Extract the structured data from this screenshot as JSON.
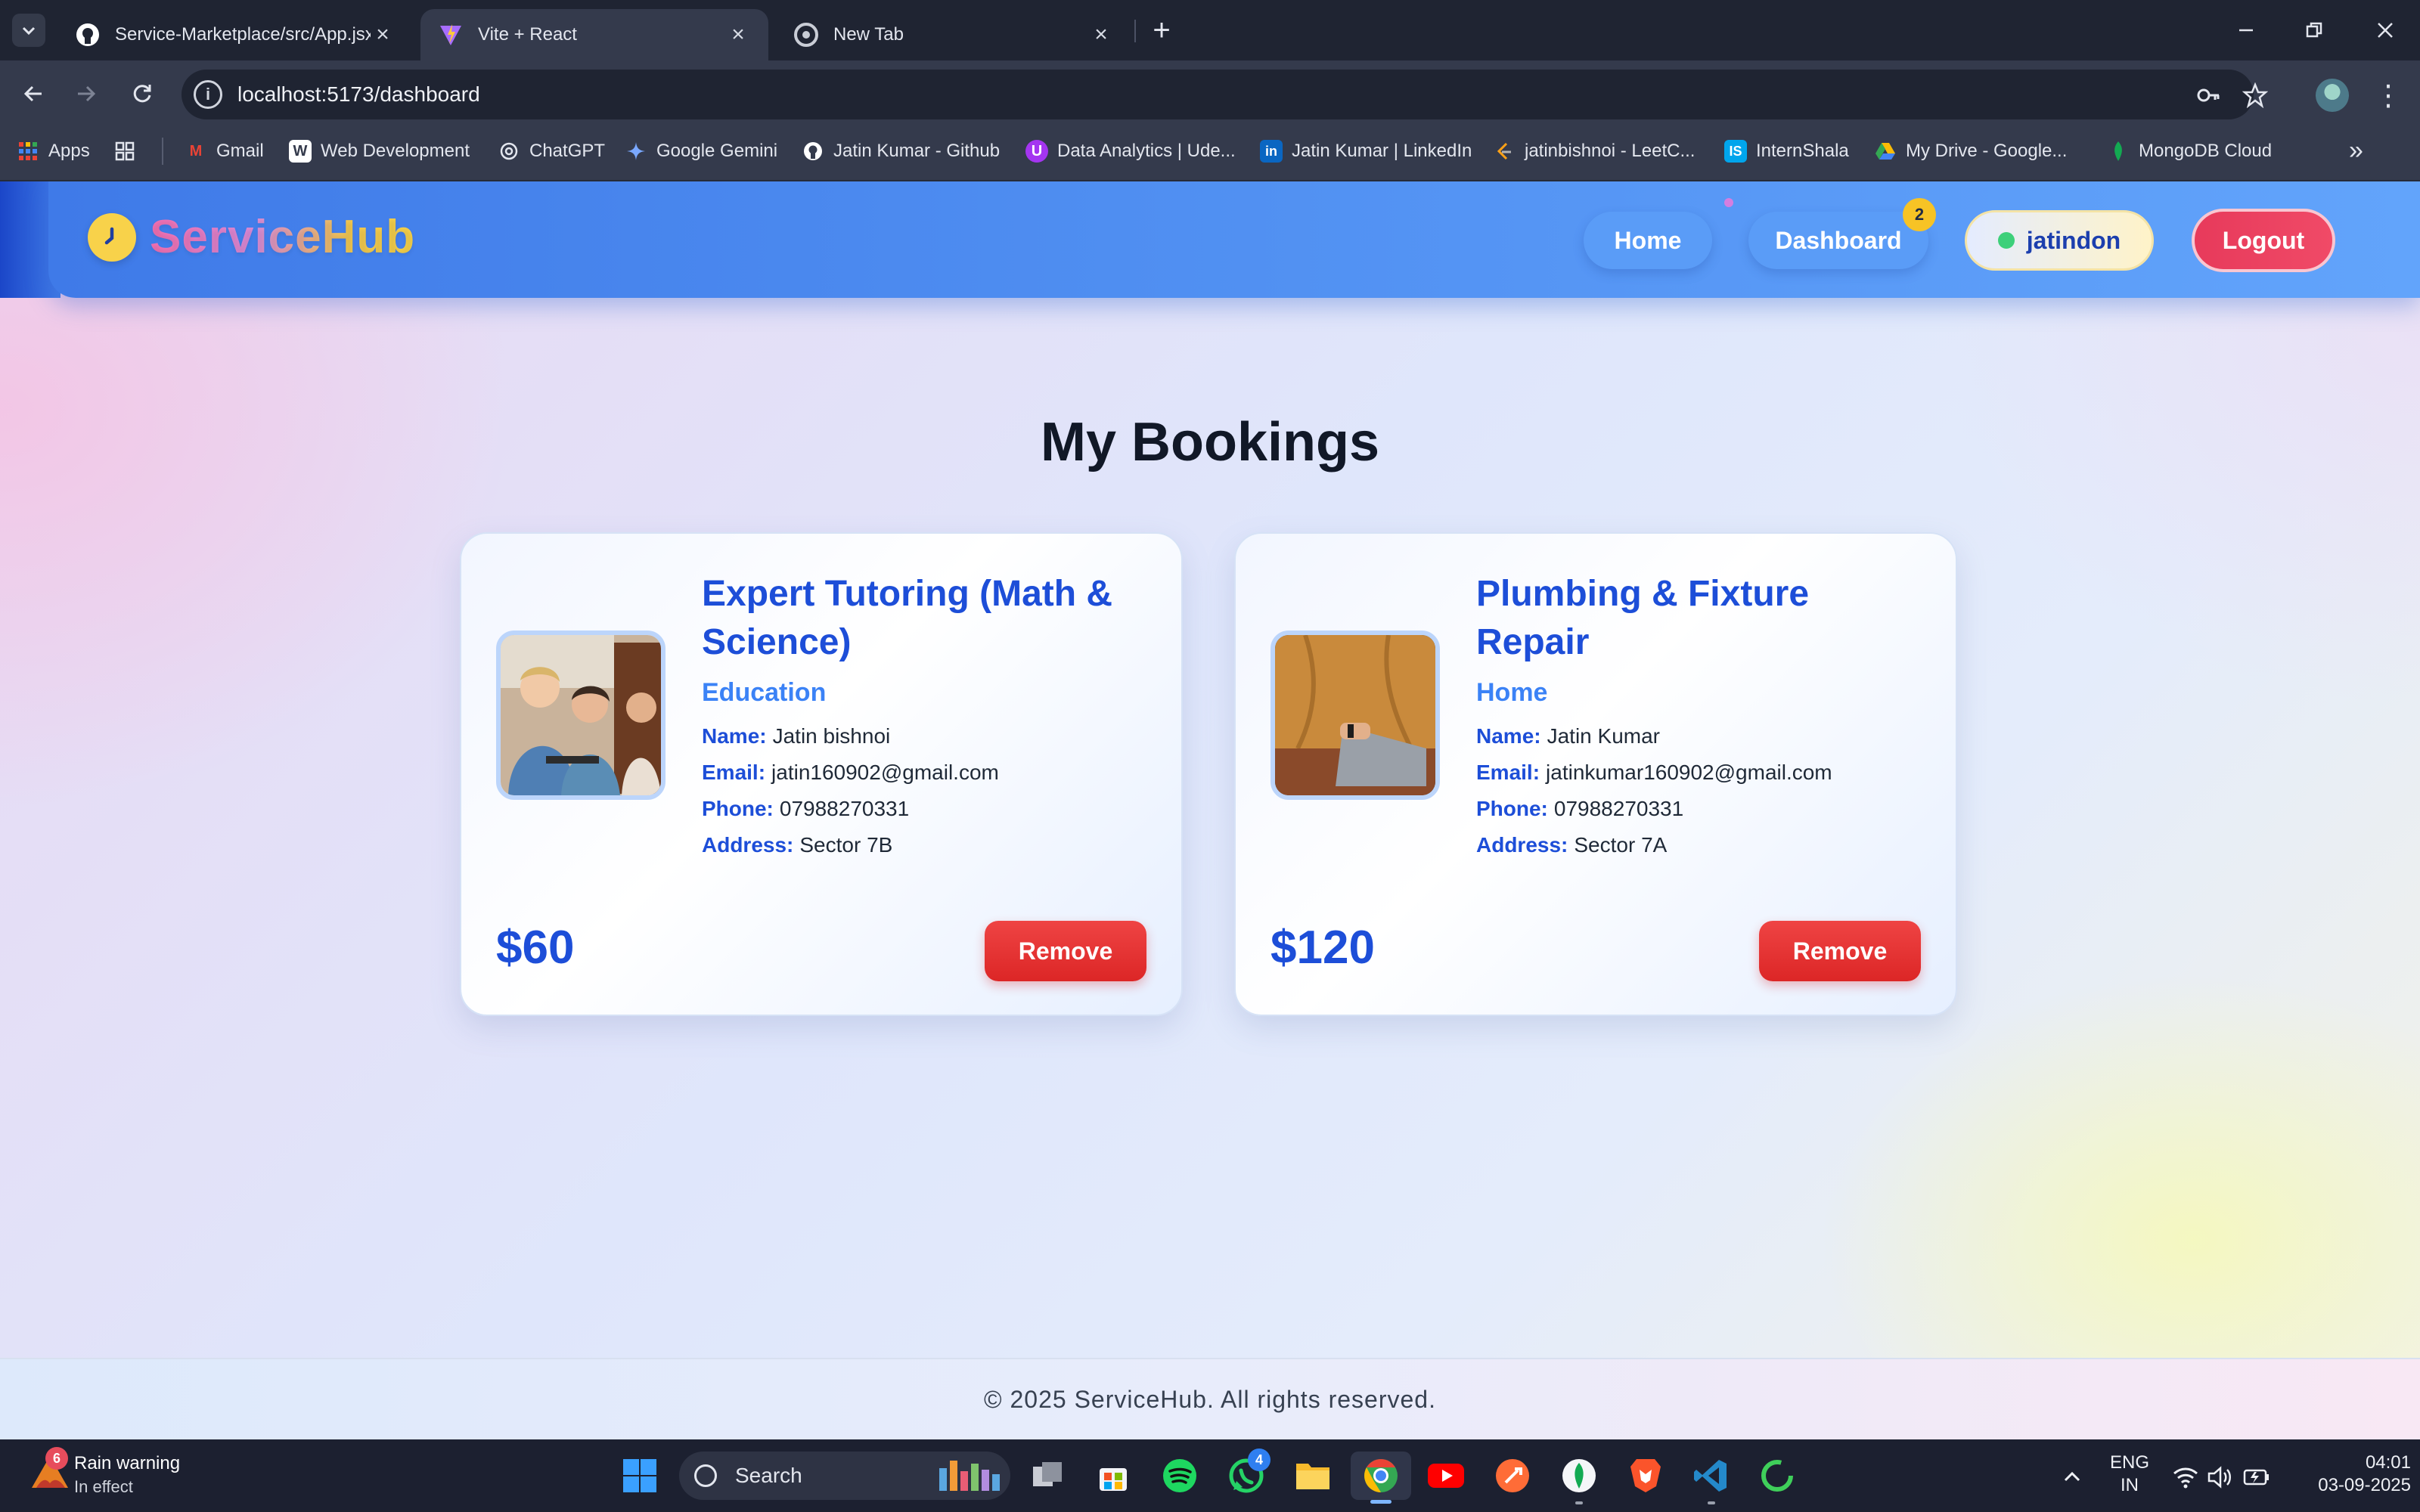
{
  "browser": {
    "tabs": [
      {
        "title": "Service-Marketplace/src/App.jsx",
        "favicon": "github-icon"
      },
      {
        "title": "Vite + React",
        "favicon": "vite-icon",
        "active": true
      },
      {
        "title": "New Tab",
        "favicon": "chrome-icon"
      }
    ],
    "url": "localhost:5173/dashboard",
    "bookmarks": [
      {
        "label": "Apps"
      },
      {
        "label": "Gmail"
      },
      {
        "label": "Web Development"
      },
      {
        "label": "ChatGPT"
      },
      {
        "label": "Google Gemini"
      },
      {
        "label": "Jatin Kumar - Github"
      },
      {
        "label": "Data Analytics | Ude..."
      },
      {
        "label": "Jatin Kumar | LinkedIn"
      },
      {
        "label": "jatinbishnoi - LeetC..."
      },
      {
        "label": "InternShala"
      },
      {
        "label": "My Drive - Google..."
      },
      {
        "label": "MongoDB Cloud"
      }
    ]
  },
  "app": {
    "brand": "ServiceHub",
    "nav": {
      "home": "Home",
      "dashboard": "Dashboard",
      "dashboard_badge": "2",
      "username": "jatindon",
      "logout": "Logout"
    },
    "heading": "My Bookings",
    "bookings": [
      {
        "title": "Expert Tutoring (Math & Science)",
        "category": "Education",
        "name_label": "Name:",
        "name": "Jatin bishnoi",
        "email_label": "Email:",
        "email": "jatin160902@gmail.com",
        "phone_label": "Phone:",
        "phone": "07988270331",
        "address_label": "Address:",
        "address": "Sector 7B",
        "price": "$60",
        "remove": "Remove"
      },
      {
        "title": "Plumbing & Fixture Repair",
        "category": "Home",
        "name_label": "Name:",
        "name": "Jatin Kumar",
        "email_label": "Email:",
        "email": "jatinkumar160902@gmail.com",
        "phone_label": "Phone:",
        "phone": "07988270331",
        "address_label": "Address:",
        "address": "Sector 7A",
        "price": "$120",
        "remove": "Remove"
      }
    ],
    "footer": "© 2025 ServiceHub. All rights reserved."
  },
  "taskbar": {
    "weather_badge": "6",
    "weather_title": "Rain warning",
    "weather_sub": "In effect",
    "search": "Search",
    "whatsapp_badge": "4",
    "lang_top": "ENG",
    "lang_bottom": "IN",
    "time": "04:01",
    "date": "03-09-2025"
  },
  "colors": {
    "primary": "#1d4ed8",
    "accent": "#3b82f6",
    "danger": "#dc2626",
    "brand_yellow": "#f8d24a"
  }
}
